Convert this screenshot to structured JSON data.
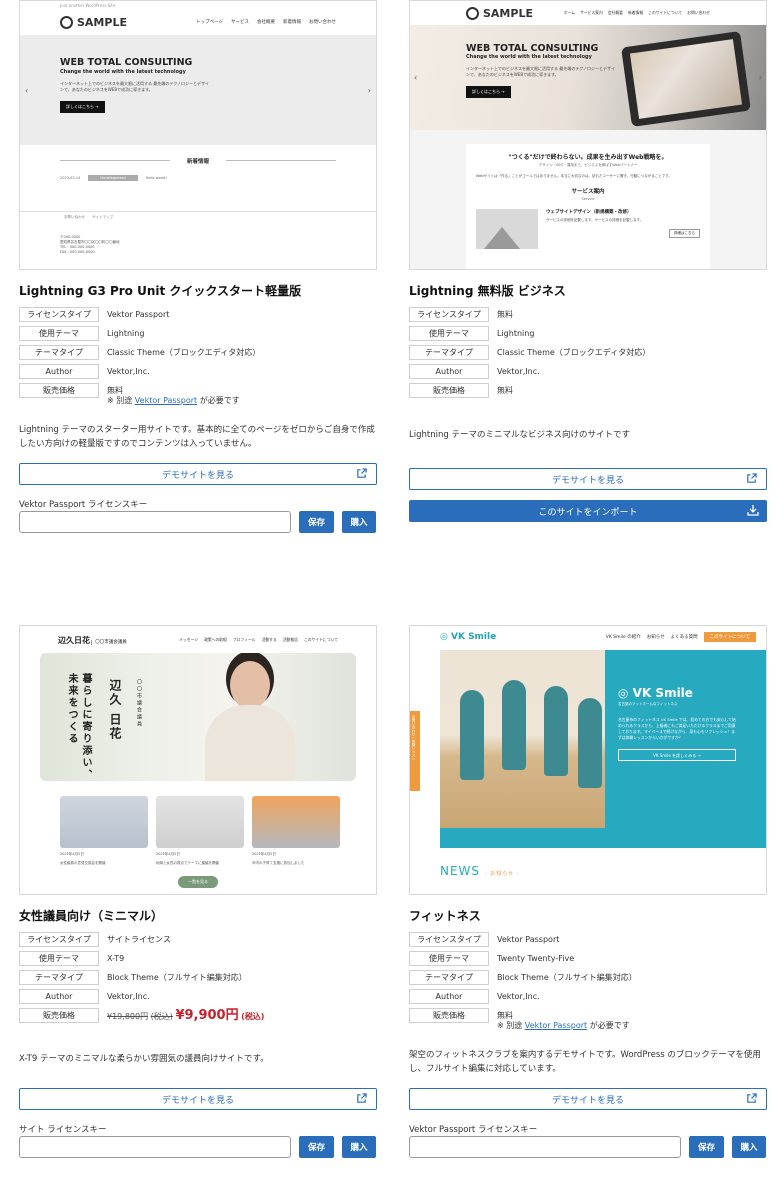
{
  "labels": {
    "license_type": "ライセンスタイプ",
    "theme": "使用テーマ",
    "theme_type": "テーマタイプ",
    "author": "Author",
    "price": "販売価格"
  },
  "demo_label": "デモサイトを見る",
  "save_label": "保存",
  "buy_label": "購入",
  "card1": {
    "title": "Lightning G3 Pro Unit クイックスタート軽量版",
    "license_type": "Vektor Passport",
    "theme": "Lightning",
    "theme_type": "Classic Theme（ブロックエディタ対応）",
    "author": "Vektor,Inc.",
    "price": "無料",
    "note_prefix": "※ 別途",
    "note_link": "Vektor Passport",
    "note_suffix": "が必要です",
    "description": "Lightning テーマのスターター用サイトです。基本的に全てのページをゼロからご自身で作成したい方向けの軽量版ですのでコンテンツは入っていません。",
    "license_key_label": "Vektor Passport ライセンスキー",
    "thumb": {
      "topline": "Just another WordPress Site",
      "logo": "SAMPLE",
      "nav": [
        "トップページ",
        "サービス",
        "会社概要",
        "新着情報",
        "お問い合わせ"
      ],
      "hero_title": "WEB TOTAL CONSULTING",
      "hero_sub": "Change the world with the latest technology",
      "hero_text": "インターネット上でのビジネスを最大限に活用する 最先端のテクノロジーとデザインで、あなたのビジネスをWEBで成功に導きます。",
      "hero_cta": "詳しくはこちら →",
      "news_title": "新着情報",
      "news_date": "2023-03-14",
      "news_tag": "Uncategorized",
      "news_text": "Hello world!",
      "footer_links": "お問い合わせ　　サイトマップ",
      "footer_addr": "〒000-0000\n愛知県名古屋市〇〇区〇〇町〇〇番地\nTEL : 000-000-0000\nFAX : 000-000-0000"
    }
  },
  "card2": {
    "title": "Lightning 無料版 ビジネス",
    "license_type": "無料",
    "theme": "Lightning",
    "theme_type": "Classic Theme（ブロックエディタ対応）",
    "author": "Vektor,Inc.",
    "price": "無料",
    "description": "Lightning テーマのミニマルなビジネス向けのサイトです",
    "import_label": "このサイトをインポート",
    "thumb": {
      "logo": "SAMPLE",
      "nav": [
        "ホーム",
        "サービス案内",
        "会社概要",
        "新着情報",
        "このサイトについて",
        "お問い合わせ"
      ],
      "hero_title": "WEB TOTAL CONSULTING",
      "hero_sub": "Change the world with the latest technology",
      "hero_text": "インターネット上でのビジネスを最大限に活用する 最先端のテクノロジーとデザインで、あなたのビジネスをWEBで成功に導きます。",
      "hero_cta": "詳しくはこちら →",
      "lead": "\"つくる\"だけで終わらない。成果を生み出すWeb戦略を。",
      "lead_sub": "デザイン・SEO・運用まで、ビジネスを伸ばすWebパートナー",
      "body": "Webサイトは「作る」ことがゴールではありません。本当に大切なのは、訪れたユーザーに響き、行動につながることです。",
      "service_title": "サービス案内",
      "service_sub": "Service",
      "service_item": "ウェブサイトデザイン（新規構築・改修）",
      "service_text": "サービスの詳細を記載します。サービスの詳細を記載します。",
      "service_more": "詳細はこちら"
    }
  },
  "card3": {
    "title": "女性議員向け（ミニマル）",
    "license_type": "サイトライセンス",
    "theme": "X-T9",
    "theme_type": "Block Theme（フルサイト編集対応）",
    "author": "Vektor,Inc.",
    "price_old": "¥19,800円",
    "price_old_tax": "(税込)",
    "price_new": "¥9,900円",
    "price_new_tax": "(税込)",
    "description": "X-T9 テーマのミニマルな柔らかい雰囲気の議員向けサイトです。",
    "license_key_label": "サイト ライセンスキー",
    "thumb": {
      "logo": "辺久日花",
      "logo_sub": "〇〇市議会議員",
      "nav": [
        "メッセージ",
        "政策への取組",
        "プロフィール",
        "活動する",
        "活動報告",
        "このサイトについて"
      ],
      "vertical": "暮らしに寄り添い、未来をつくる",
      "name": "辺久 日花",
      "role": "〇〇市議会議員",
      "dates": [
        "2025年4月2日",
        "2025年4月2日",
        "2025年4月2日"
      ],
      "captions": [
        "女性議員の意見交換会を開催",
        "地域と女性の視点でテーマに建議を開催",
        "市内の子育て支援に参加しました"
      ],
      "more": "一覧を見る"
    }
  },
  "card4": {
    "title": "フィットネス",
    "license_type": "Vektor Passport",
    "theme": "Twenty Twenty-Five",
    "theme_type": "Block Theme（フルサイト編集対応）",
    "author": "Vektor,Inc.",
    "price": "無料",
    "note_prefix": "※ 別途",
    "note_link": "Vektor Passport",
    "note_suffix": "が必要です",
    "description": "架空のフィットネスクラブを案内するデモサイトです。WordPress のブロックテーマを使用し、フルサイト編集に対応しています。",
    "license_key_label": "Vektor Passport ライセンスキー",
    "thumb": {
      "logo": "VK Smile",
      "nav": [
        "VK Smile の紹介",
        "お知らせ",
        "よくある質問"
      ],
      "nav_cta": "このサイトについて",
      "hero_title": "VK Smile",
      "hero_sub": "名古屋のアットホームなフィットネス",
      "hero_text": "名古屋市のフィットネス VK Smile では、初めての方でも安心して始められるクラスから、上級者にもご満足いただけるクラスまでご用意しております。マイペースで続けながら、身も心もリフレッシュ！まずは体験レッスンからいかがですか？",
      "hero_btn": "VK Smile を詳しくみる →",
      "side_tab": "お問い合わせ / 体験レッスン",
      "news": "NEWS",
      "news_sub": "- お知らせ -"
    }
  }
}
